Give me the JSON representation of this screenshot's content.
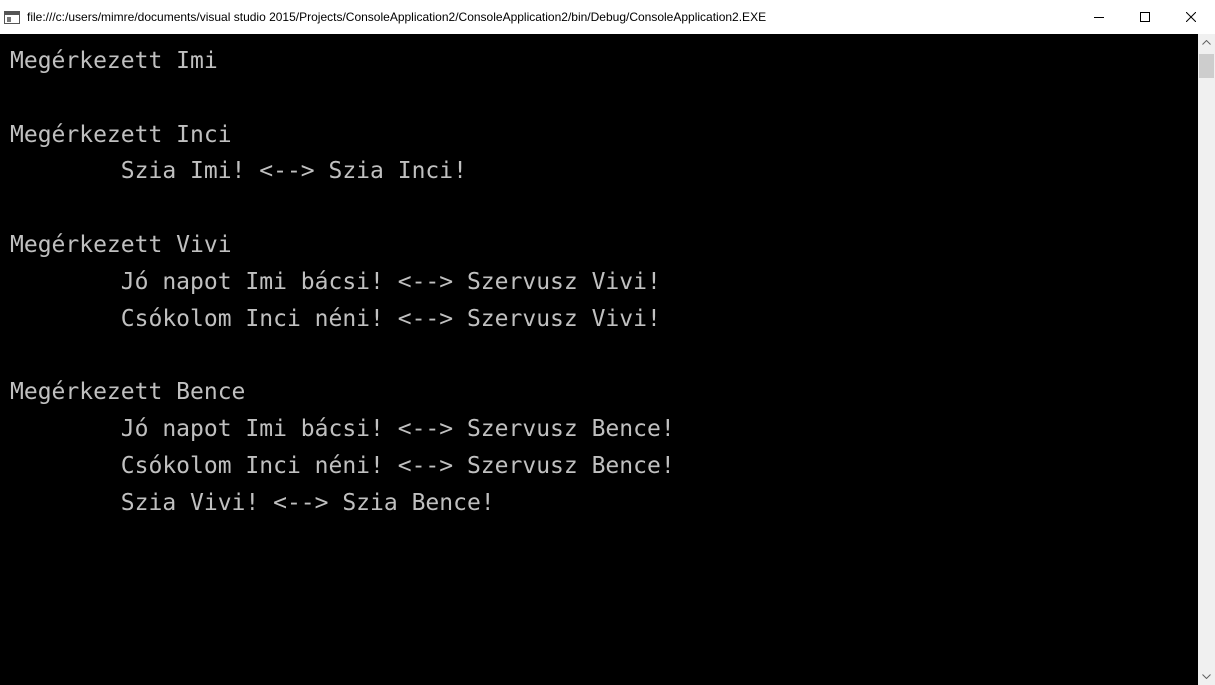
{
  "window": {
    "title": "file:///c:/users/mimre/documents/visual studio 2015/Projects/ConsoleApplication2/ConsoleApplication2/bin/Debug/ConsoleApplication2.EXE",
    "controls": {
      "minimize_icon": "minimize-icon",
      "maximize_icon": "maximize-icon",
      "close_icon": "close-icon"
    }
  },
  "console": {
    "background": "#000000",
    "text_color": "#c0c0c0",
    "lines": [
      "Megérkezett Imi",
      "",
      "Megérkezett Inci",
      "        Szia Imi! <--> Szia Inci!",
      "",
      "Megérkezett Vivi",
      "        Jó napot Imi bácsi! <--> Szervusz Vivi!",
      "        Csókolom Inci néni! <--> Szervusz Vivi!",
      "",
      "Megérkezett Bence",
      "        Jó napot Imi bácsi! <--> Szervusz Bence!",
      "        Csókolom Inci néni! <--> Szervusz Bence!",
      "        Szia Vivi! <--> Szia Bence!"
    ]
  }
}
